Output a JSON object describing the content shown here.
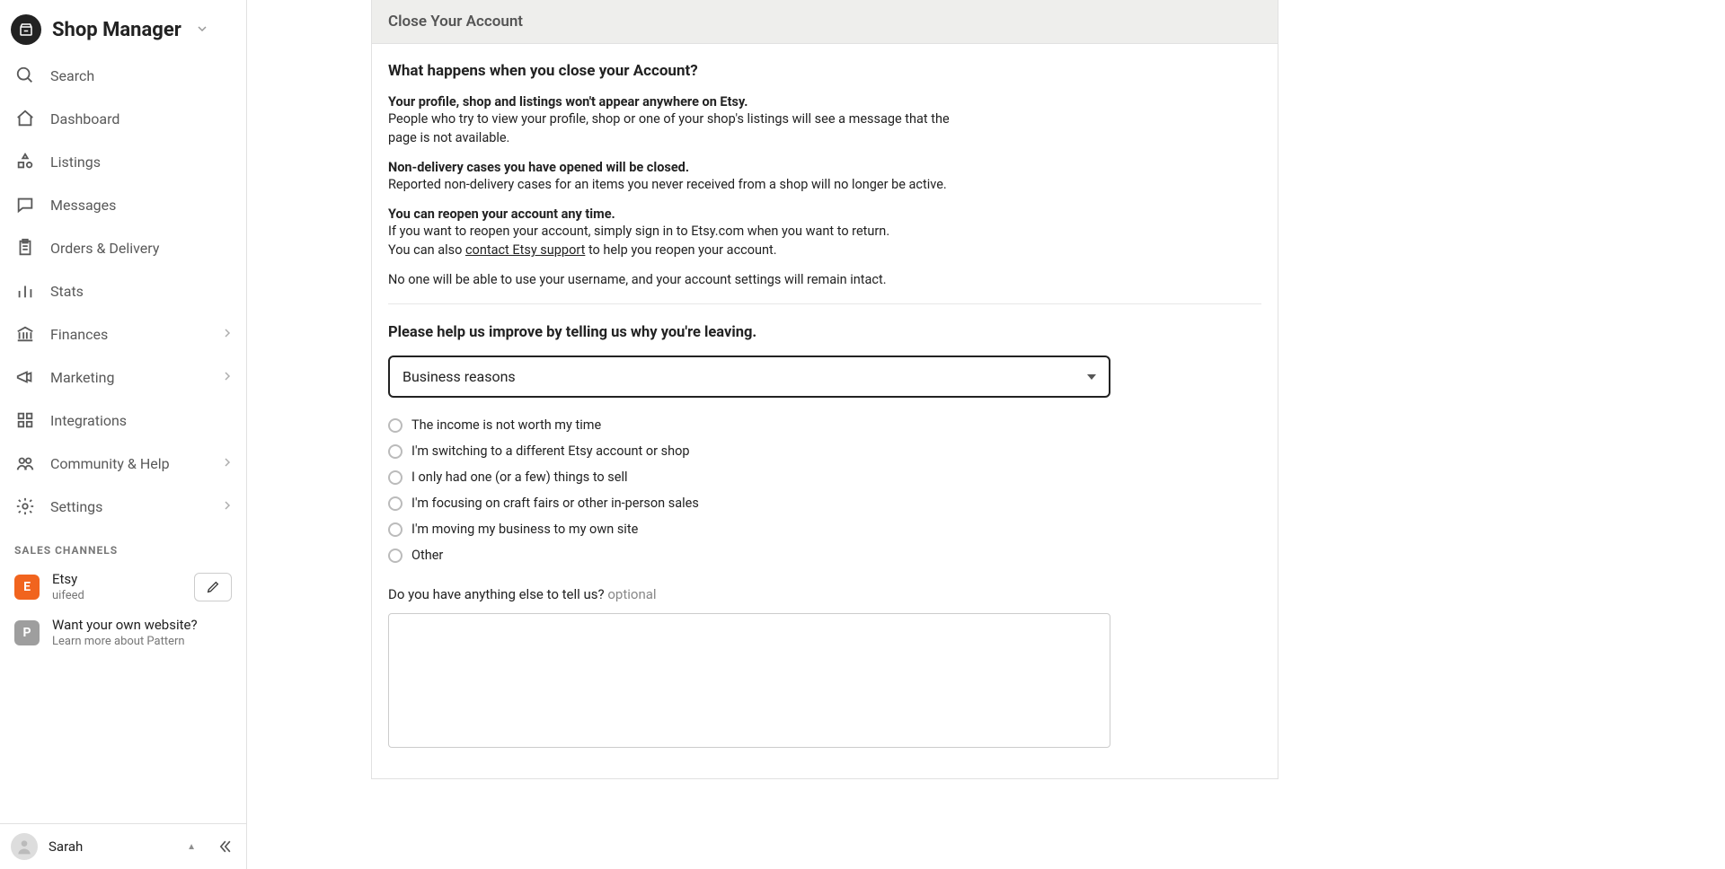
{
  "brand": {
    "title": "Shop Manager"
  },
  "sidebar": {
    "items": [
      {
        "label": "Search"
      },
      {
        "label": "Dashboard"
      },
      {
        "label": "Listings"
      },
      {
        "label": "Messages"
      },
      {
        "label": "Orders & Delivery"
      },
      {
        "label": "Stats"
      },
      {
        "label": "Finances",
        "expandable": true
      },
      {
        "label": "Marketing",
        "expandable": true
      },
      {
        "label": "Integrations"
      },
      {
        "label": "Community & Help",
        "expandable": true
      },
      {
        "label": "Settings",
        "expandable": true
      }
    ],
    "section_header": "SALES CHANNELS",
    "channels": {
      "etsy": {
        "badge": "E",
        "title": "Etsy",
        "subtitle": "uifeed"
      },
      "pattern": {
        "badge": "P",
        "title": "Want your own website?",
        "subtitle": "Learn more about Pattern"
      }
    },
    "user": {
      "name": "Sarah"
    }
  },
  "main": {
    "panel_title": "Close Your Account",
    "heading": "What happens when you close your Account?",
    "blocks": [
      {
        "strong": "Your profile, shop and listings won't appear anywhere on Etsy.",
        "desc": "People who try to view your profile, shop or one of your shop's listings will see a message that the page is not available."
      },
      {
        "strong": "Non-delivery cases you have opened will be closed.",
        "desc": "Reported non-delivery cases for an items you never received from a shop will no longer be active."
      },
      {
        "strong": "You can reopen your account any time.",
        "desc_pre": "If you want to reopen your account, simply sign in to Etsy.com when you want to return.",
        "desc_line2_pre": "You can also ",
        "desc_link": "contact Etsy support",
        "desc_line2_post": " to help you reopen your account."
      }
    ],
    "note": "No one will be able to use your username, and your account settings will remain intact.",
    "improve_title": "Please help us improve by telling us why you're leaving.",
    "select_value": "Business reasons",
    "radios": [
      "The income is not worth my time",
      "I'm switching to a different Etsy account or shop",
      "I only had one (or a few) things to sell",
      "I'm focusing on craft fairs or other in-person sales",
      "I'm moving my business to my own site",
      "Other"
    ],
    "extra_label": "Do you have anything else to tell us?",
    "extra_optional": "optional"
  }
}
